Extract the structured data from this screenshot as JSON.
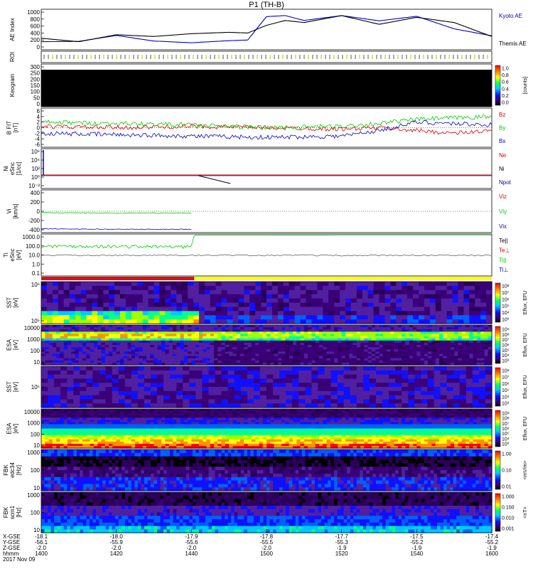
{
  "title": "P1 (TH-B)",
  "colors": {
    "blue": "#0000cc",
    "red": "#dd0000",
    "green": "#00cc00",
    "black": "#000000",
    "bar_red": "#dd1111",
    "bar_yellow": "#ffff00"
  },
  "panels": [
    {
      "id": "ae",
      "ylabel": [
        "AE Index"
      ],
      "ticks": [
        "1000",
        "800",
        "600",
        "400",
        "200",
        "0"
      ],
      "legend": [
        {
          "text": "Kyoto AE",
          "color": "#0000cc"
        },
        {
          "text": "Themis AE",
          "color": "#000000"
        }
      ],
      "colorbar": null
    },
    {
      "id": "roi",
      "ylabel": [
        "ROI"
      ],
      "ticks": [],
      "legend": [],
      "colorbar": null
    },
    {
      "id": "keogram",
      "ylabel": [
        "Keogram"
      ],
      "ticks": [
        "300",
        "250",
        "200",
        "150",
        "100",
        "50",
        "0"
      ],
      "legend": [],
      "colorbar": {
        "labels": [
          "1.0",
          "0.8",
          "0.6",
          "0.4",
          "0.2",
          "0.0"
        ],
        "title": "[counts]"
      }
    },
    {
      "id": "bfield",
      "ylabel": [
        "B FIT",
        "[nT]"
      ],
      "ticks": [
        "6",
        "4",
        "2",
        "0",
        "-2",
        "-4",
        "-6"
      ],
      "legend": [
        {
          "text": "Bz",
          "color": "#dd0000"
        },
        {
          "text": "By",
          "color": "#00cc00"
        },
        {
          "text": "Bx",
          "color": "#0000cc"
        }
      ],
      "colorbar": null
    },
    {
      "id": "density",
      "ylabel": [
        "Ni",
        "eSnc",
        "[1/cc]"
      ],
      "ticks": [
        "10⁶",
        "10⁴",
        "10²",
        "10⁰",
        "10⁻²"
      ],
      "legend": [
        {
          "text": "Ne",
          "color": "#dd0000"
        },
        {
          "text": "Ni",
          "color": "#000000"
        },
        {
          "text": "Npot",
          "color": "#0000cc"
        }
      ],
      "colorbar": null
    },
    {
      "id": "velocity",
      "ylabel": [
        "Vi",
        "[km/s]"
      ],
      "ticks": [
        "400",
        "200",
        "0",
        "-200",
        "-400"
      ],
      "legend": [
        {
          "text": "Viz",
          "color": "#dd0000"
        },
        {
          "text": "Viy",
          "color": "#00cc00"
        },
        {
          "text": "Vix",
          "color": "#0000cc"
        }
      ],
      "colorbar": null
    },
    {
      "id": "temp",
      "ylabel": [
        "Ti",
        "eSnc",
        "[eV]"
      ],
      "ticks": [
        "1000.0",
        "100.0",
        "10.0",
        "1.0",
        "0.1"
      ],
      "legend": [
        {
          "text": "Te||",
          "color": "#000000"
        },
        {
          "text": "Te⊥",
          "color": "#dd0000"
        },
        {
          "text": "Ti||",
          "color": "#00cc00"
        },
        {
          "text": "Ti⊥",
          "color": "#0000cc"
        }
      ],
      "colorbar": null
    },
    {
      "id": "sst_e",
      "ylabel": [
        "SST",
        "[eV]"
      ],
      "ticks": [
        "10⁶",
        "10⁵"
      ],
      "legend": [],
      "colorbar": {
        "labels": [
          "10⁸",
          "10⁷",
          "10⁶",
          "10⁵",
          "10⁴",
          "10³"
        ],
        "title": "Eflux, EFU"
      }
    },
    {
      "id": "esa_e",
      "ylabel": [
        "ESA",
        "[eV]"
      ],
      "ticks": [
        "10000",
        "1000",
        "100",
        "10"
      ],
      "legend": [],
      "colorbar": {
        "labels": [
          "10⁹",
          "10⁸",
          "10⁷",
          "10⁶",
          "10⁵",
          "10⁴",
          "10³"
        ],
        "title": "Eflux, EFU"
      }
    },
    {
      "id": "sst_i",
      "ylabel": [
        "SST",
        "[eV]"
      ],
      "ticks": [
        "10⁵"
      ],
      "legend": [],
      "colorbar": {
        "labels": [
          "10⁸",
          "10⁷",
          "10⁶",
          "10⁵",
          "10⁴",
          "10³"
        ],
        "title": "Eflux, EFU"
      }
    },
    {
      "id": "esa_i",
      "ylabel": [
        "ESA",
        "[eV]"
      ],
      "ticks": [
        "10000",
        "1000",
        "100",
        "10"
      ],
      "legend": [],
      "colorbar": {
        "labels": [
          "10⁹",
          "10⁸",
          "10⁷",
          "10⁶",
          "10⁵",
          "10⁴",
          "10³"
        ],
        "title": "Eflux, EFU"
      }
    },
    {
      "id": "fbk_e",
      "ylabel": [
        "FBK",
        "edc34",
        "[Hz]"
      ],
      "ticks": [
        "1000",
        "100",
        "10"
      ],
      "legend": [],
      "colorbar": {
        "labels": [
          "1.00",
          "0.10",
          "0.01"
        ],
        "title": "<mV/m>"
      }
    },
    {
      "id": "fbk_b",
      "ylabel": [
        "FBK",
        "scm1",
        "[Hz]"
      ],
      "ticks": [
        "1000",
        "100",
        "10"
      ],
      "legend": [],
      "colorbar": {
        "labels": [
          "1.000",
          "0.100",
          "0.010",
          "0.001"
        ],
        "title": "<nT>"
      }
    }
  ],
  "footer": {
    "row_labels": [
      "X-GSE",
      "Y-GSE",
      "Z-GSE",
      "hhmm",
      "2017 Nov 09"
    ],
    "columns": [
      [
        "-18.1",
        "-56.1",
        "-2.0",
        "1400"
      ],
      [
        "-18.0",
        "-55.9",
        "-2.0",
        "1420"
      ],
      [
        "-17.9",
        "-55.6",
        "-2.0",
        "1440"
      ],
      [
        "-17.8",
        "-55.5",
        "-2.0",
        "1500"
      ],
      [
        "-17.7",
        "-55.3",
        "-1.9",
        "1520"
      ],
      [
        "-17.5",
        "-55.2",
        "-1.9",
        "1540"
      ],
      [
        "-17.4",
        "-55.2",
        "-1.9",
        "1600"
      ]
    ]
  },
  "chart_data": {
    "type": "line",
    "title": "P1 (TH-B)",
    "x_label": "hhmm",
    "x_ticks": [
      "1400",
      "1420",
      "1440",
      "1500",
      "1520",
      "1540",
      "1600"
    ],
    "x_range": [
      "1400",
      "1600"
    ],
    "series": [
      {
        "name": "Kyoto AE",
        "panel": "AE Index",
        "x": [
          "1400",
          "1410",
          "1420",
          "1430",
          "1440",
          "1450",
          "1455",
          "1500",
          "1505",
          "1510",
          "1520",
          "1530",
          "1540",
          "1550",
          "1600"
        ],
        "values": [
          150,
          160,
          330,
          170,
          120,
          180,
          200,
          870,
          900,
          760,
          900,
          750,
          880,
          520,
          320
        ]
      },
      {
        "name": "Themis AE",
        "panel": "AE Index",
        "x": [
          "1400",
          "1410",
          "1420",
          "1430",
          "1440",
          "1450",
          "1455",
          "1500",
          "1505",
          "1510",
          "1520",
          "1530",
          "1540",
          "1550",
          "1600"
        ],
        "values": [
          250,
          150,
          350,
          300,
          380,
          420,
          400,
          620,
          760,
          700,
          900,
          650,
          850,
          700,
          300
        ]
      },
      {
        "name": "Bz",
        "panel": "B FIT",
        "x": [
          "1400",
          "1420",
          "1440",
          "1500",
          "1520",
          "1530",
          "1540",
          "1550",
          "1600"
        ],
        "values": [
          0.5,
          0,
          0.5,
          0,
          -0.5,
          0,
          -1,
          -2,
          -1
        ]
      },
      {
        "name": "By",
        "panel": "B FIT",
        "x": [
          "1400",
          "1420",
          "1440",
          "1500",
          "1520",
          "1530",
          "1540",
          "1550",
          "1600"
        ],
        "values": [
          2,
          1.5,
          1,
          0,
          0.5,
          1.5,
          3,
          3.5,
          4
        ]
      },
      {
        "name": "Bx",
        "panel": "B FIT",
        "x": [
          "1400",
          "1420",
          "1440",
          "1500",
          "1520",
          "1530",
          "1540",
          "1550",
          "1600"
        ],
        "values": [
          -2,
          -2.5,
          -3,
          -3.5,
          -3,
          -1,
          2,
          1.5,
          1
        ]
      },
      {
        "name": "Viy",
        "panel": "Vi",
        "x": [
          "1400",
          "1420",
          "1440"
        ],
        "values": [
          -30,
          -40,
          -40
        ]
      },
      {
        "name": "Vix",
        "panel": "Vi",
        "x": [
          "1400",
          "1420",
          "1440"
        ],
        "values": [
          -380,
          -390,
          -390
        ]
      },
      {
        "name": "Ti||",
        "panel": "Ti",
        "x": [
          "1400",
          "1420",
          "1440",
          "1441",
          "1500",
          "1600"
        ],
        "values": [
          100,
          90,
          80,
          1500,
          1500,
          1600
        ]
      }
    ]
  }
}
